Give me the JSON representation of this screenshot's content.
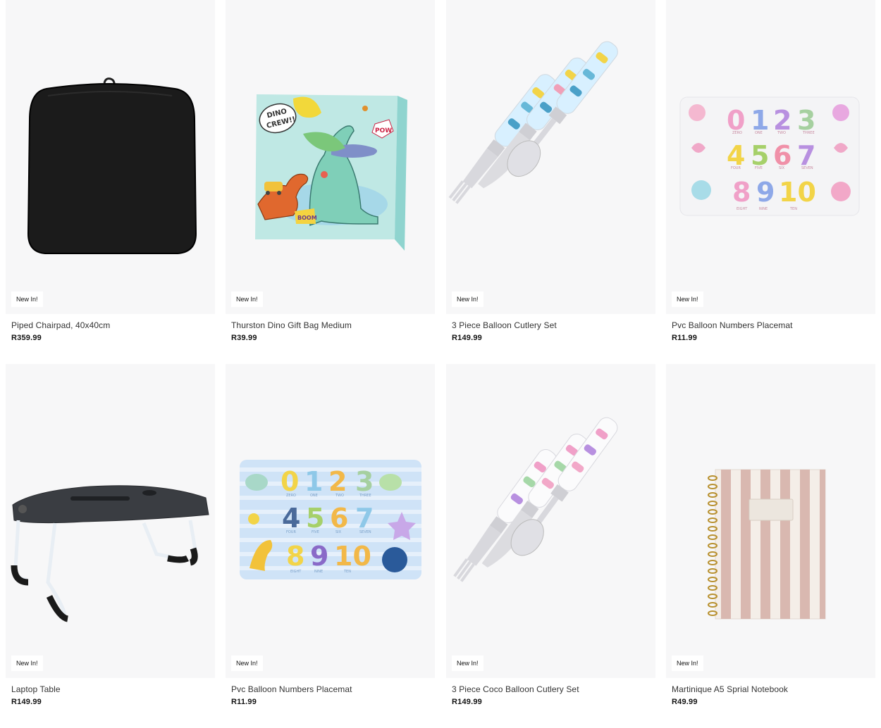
{
  "products": [
    {
      "badge": "New In!",
      "title": "Piped Chairpad, 40x40cm",
      "price": "R359.99",
      "image_icon": "black-chairpad-image"
    },
    {
      "badge": "New In!",
      "title": "Thurston Dino Gift Bag Medium",
      "price": "R39.99",
      "image_icon": "dino-gift-bag-image",
      "image_text": [
        "DINO",
        "CREW!!",
        "POW",
        "BOOM"
      ]
    },
    {
      "badge": "New In!",
      "title": "3 Piece Balloon Cutlery Set",
      "price": "R149.99",
      "image_icon": "cutlery-set-image"
    },
    {
      "badge": "New In!",
      "title": "Pvc Balloon Numbers Placemat",
      "price": "R11.99",
      "image_icon": "placemat-pink-image",
      "image_text": [
        "0",
        "1",
        "2",
        "3",
        "4",
        "5",
        "6",
        "7",
        "8",
        "9",
        "10",
        "ZERO",
        "ONE",
        "TWO",
        "THREE",
        "FOUR",
        "FIVE",
        "SIX",
        "SEVEN",
        "EIGHT",
        "NINE",
        "TEN"
      ]
    },
    {
      "badge": "New In!",
      "title": "Laptop Table",
      "price": "R149.99",
      "image_icon": "laptop-table-image"
    },
    {
      "badge": "New In!",
      "title": "Pvc Balloon Numbers Placemat",
      "price": "R11.99",
      "image_icon": "placemat-blue-image",
      "image_text": [
        "0",
        "1",
        "2",
        "3",
        "4",
        "5",
        "6",
        "7",
        "8",
        "9",
        "10",
        "ZERO",
        "ONE",
        "TWO",
        "THREE",
        "FOUR",
        "FIVE",
        "SIX",
        "SEVEN",
        "EIGHT",
        "NINE",
        "TEN"
      ]
    },
    {
      "badge": "New In!",
      "title": "3 Piece Coco Balloon Cutlery Set",
      "price": "R149.99",
      "image_icon": "cutlery-set-pink-image"
    },
    {
      "badge": "New In!",
      "title": "Martinique A5 Sprial Notebook",
      "price": "R49.99",
      "image_icon": "striped-notebook-image"
    }
  ],
  "colors": {
    "image_bg": "#f7f7f8",
    "price_text": "#111111",
    "title_text": "#333333"
  }
}
